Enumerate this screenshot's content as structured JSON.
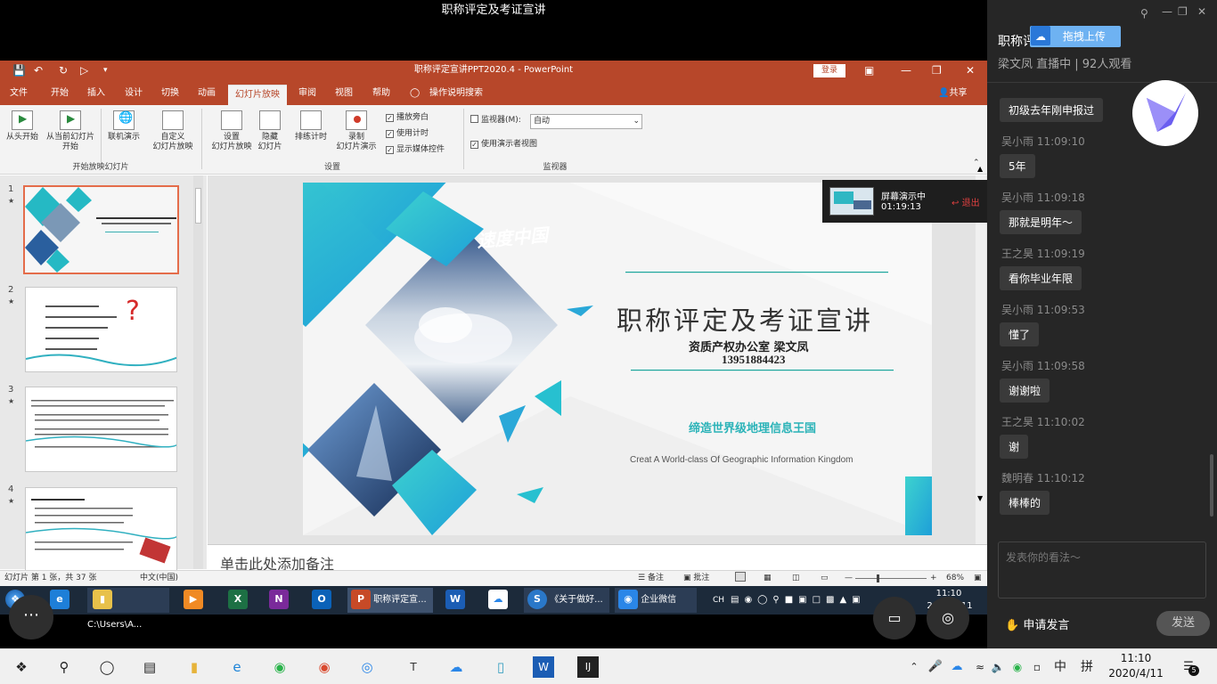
{
  "meeting_title": "职称评定及考证宣讲",
  "ppt": {
    "window_title": "职称评定宣讲PPT2020.4  -  PowerPoint",
    "login_label": "登录",
    "tabs": [
      "文件",
      "开始",
      "插入",
      "设计",
      "切换",
      "动画",
      "幻灯片放映",
      "审阅",
      "视图",
      "帮助"
    ],
    "active_tab": "幻灯片放映",
    "search_label": "操作说明搜索",
    "share_label": "共享",
    "ribbon": {
      "from_start": "从头开始",
      "from_current_1": "从当前幻灯片",
      "from_current_2": "开始",
      "online_present": "联机演示",
      "custom_show_1": "自定义",
      "custom_show_2": "幻灯片放映",
      "group_start": "开始放映幻灯片",
      "setup_show_1": "设置",
      "setup_show_2": "幻灯片放映",
      "hide_slide_1": "隐藏",
      "hide_slide_2": "幻灯片",
      "rehearse": "排练计时",
      "record_1": "录制",
      "record_2": "幻灯片演示",
      "play_narration": "播放旁白",
      "use_timings": "使用计时",
      "show_media_controls": "显示媒体控件",
      "group_setup": "设置",
      "monitor_label": "监视器(M):",
      "monitor_value": "自动",
      "presenter_view": "使用演示者视图",
      "group_monitor": "监视器"
    },
    "thumbnails": [
      {
        "num": "1",
        "star": "★"
      },
      {
        "num": "2",
        "star": "★"
      },
      {
        "num": "3",
        "star": "★"
      },
      {
        "num": "4",
        "star": "★"
      }
    ],
    "slide": {
      "logo_text": "速度中国",
      "title": "职称评定及考证宣讲",
      "office": "资质产权办公室  梁文凤",
      "phone": "13951884423",
      "slogan": "缔造世界级地理信息王国",
      "english": "Creat A World-class Of Geographic Information Kingdom"
    },
    "notes_placeholder": "单击此处添加备注",
    "status": {
      "slide_info": "幻灯片 第 1 张，共 37 张",
      "language": "中文(中国)",
      "notes": "备注",
      "comments": "批注",
      "zoom": "68%"
    }
  },
  "projection": {
    "status": "屏幕演示中",
    "time": "01:19:13",
    "exit_label": "退出"
  },
  "inner_taskbar": {
    "explorer": "C:\\Users\\A...",
    "ppt": "职称评定宣...",
    "doc": "《关于做好...",
    "wecom": "企业微信",
    "ime": "CH",
    "time": "11:10",
    "date": "2020/4/11"
  },
  "chat": {
    "title": "职称评",
    "upload_label": "拖拽上传",
    "subtitle": "梁文凤 直播中 | 92人观看",
    "messages": [
      {
        "user": "",
        "time": "",
        "text": "初级去年刚申报过"
      },
      {
        "user": "吴小雨",
        "time": "11:09:10",
        "text": "5年"
      },
      {
        "user": "吴小雨",
        "time": "11:09:18",
        "text": "那就是明年～"
      },
      {
        "user": "王之昊",
        "time": "11:09:19",
        "text": "看你毕业年限"
      },
      {
        "user": "吴小雨",
        "time": "11:09:53",
        "text": "懂了"
      },
      {
        "user": "吴小雨",
        "time": "11:09:58",
        "text": "谢谢啦"
      },
      {
        "user": "王之昊",
        "time": "11:10:02",
        "text": "谢"
      },
      {
        "user": "魏明春",
        "time": "11:10:12",
        "text": "棒棒的"
      }
    ],
    "input_placeholder": "发表你的看法～",
    "request_speak": "申请发言",
    "send_label": "发送"
  },
  "win_taskbar": {
    "ime": "中",
    "ime2": "拼",
    "time": "11:10",
    "date": "2020/4/11",
    "notifications": "5"
  }
}
